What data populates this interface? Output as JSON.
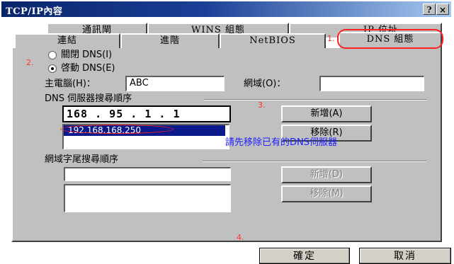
{
  "window": {
    "title": "TCP/IP內容",
    "help_button": "?",
    "close_button": "×"
  },
  "tabs_back": [
    "通訊閘",
    "WINS 組態",
    "IP 位址"
  ],
  "tabs_front": [
    "連結",
    "進階",
    "NetBIOS",
    "DNS 組態"
  ],
  "dns": {
    "disable_label": "關閉 DNS(I)",
    "enable_label": "啓動 DNS(E)",
    "enabled": true,
    "host_label": "主電腦(H)：",
    "host_value": "ABC",
    "domain_label": "網域(O)：",
    "domain_value": "",
    "server_order_label": "DNS 伺服器搜尋順序",
    "server_input": "168 . 95 . 1 . 1",
    "server_list": [
      "192.168.168.250"
    ],
    "add_label": "新增(A)",
    "remove_label": "移除(R)",
    "hint": "請先移除已有的DNS伺服器",
    "suffix_order_label": "網域字尾搜尋順序",
    "suffix_input": "",
    "suffix_add_label": "新增(D)",
    "suffix_remove_label": "移除(M)"
  },
  "annotations": [
    "1.",
    "2.",
    "3.",
    "4."
  ],
  "footer": {
    "ok_label": "確定",
    "cancel_label": "取消"
  },
  "colors": {
    "title_bar": "#08246b",
    "face": "#c0c0c0",
    "annotation": "#ff2020",
    "hint_text": "#2020ff",
    "selection": "#0a1a8a"
  }
}
